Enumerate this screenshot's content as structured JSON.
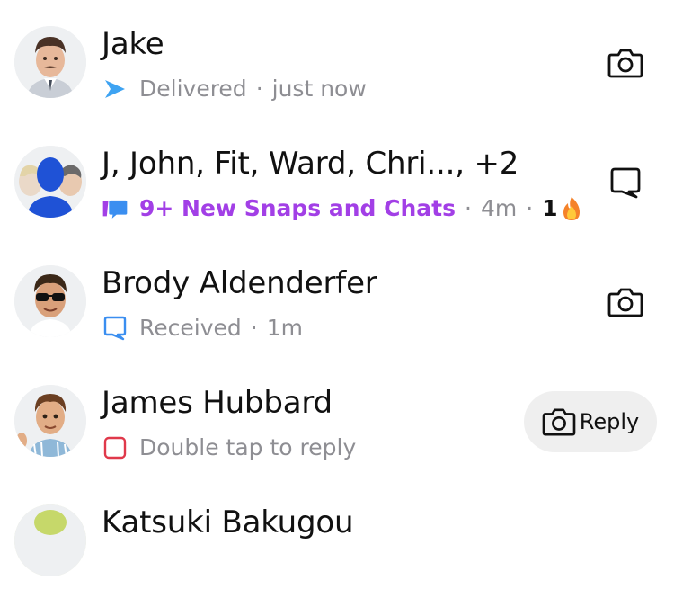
{
  "chats": [
    {
      "name": "Jake",
      "status": "Delivered",
      "time": "just now",
      "action_icon": "camera-icon"
    },
    {
      "name": "J, John, Fit, Ward, Chri..., +2",
      "status": "9+ New Snaps and Chats",
      "time": "4m",
      "streak": "1",
      "streak_icon": "fire-icon",
      "action_icon": "chat-icon"
    },
    {
      "name": "Brody Aldenderfer",
      "status": "Received",
      "time": "1m",
      "action_icon": "camera-icon"
    },
    {
      "name": "James Hubbard",
      "status": "Double tap to reply",
      "action_label": "Reply",
      "action_icon": "camera-icon"
    },
    {
      "name": "Katsuki Bakugou"
    }
  ],
  "separator": "·",
  "colors": {
    "delivered_arrow": "#3ea3f2",
    "new_chats_purple": "#a23fe6",
    "received_blue": "#3a8ef0",
    "reply_red": "#e0394b",
    "muted_text": "#8e8e93"
  }
}
